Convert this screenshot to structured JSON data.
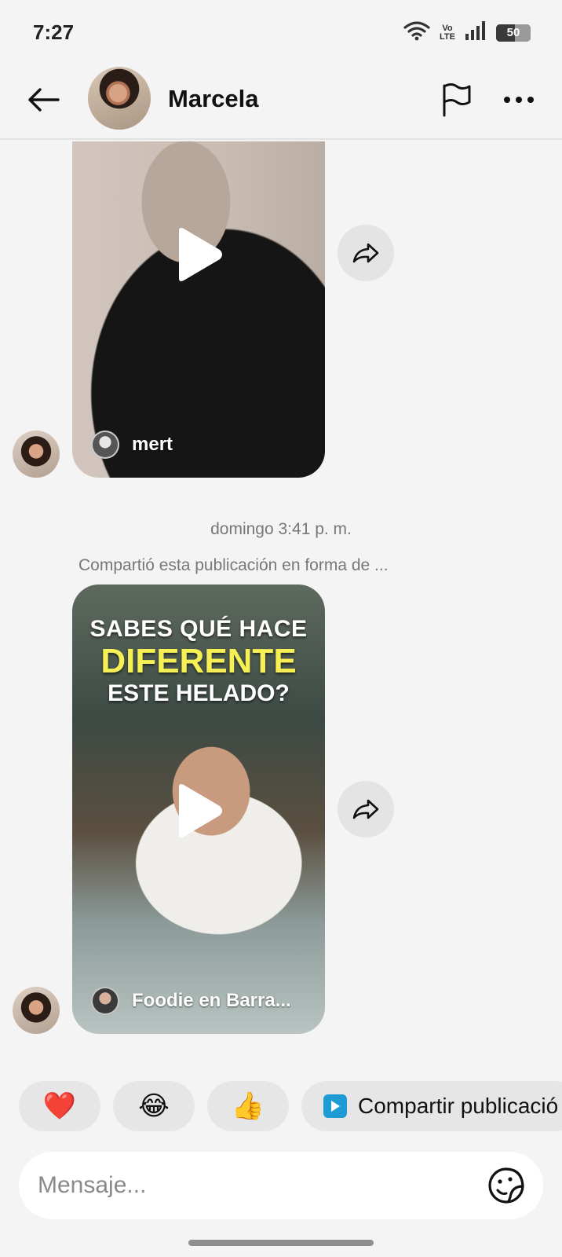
{
  "status_bar": {
    "time": "7:27",
    "volte_top": "Vo",
    "volte_bottom": "LTE",
    "battery": "50",
    "icons": [
      "wifi-icon",
      "volte-icon",
      "signal-icon",
      "battery-icon"
    ]
  },
  "header": {
    "contact_name": "Marcela",
    "icons": [
      "back-arrow-icon",
      "flag-icon",
      "more-dots-icon"
    ]
  },
  "messages": [
    {
      "type": "reel",
      "author": "mert",
      "icons": [
        "play-icon",
        "share-icon"
      ]
    },
    {
      "type": "reel",
      "timestamp": "domingo 3:41 p. m.",
      "shared_caption": "Compartió esta publicación en forma de ...",
      "title_line_1": "SABES QUÉ HACE",
      "title_line_2": "DIFERENTE",
      "title_line_3": "ESTE HELADO?",
      "author": "Foodie en Barra...",
      "icons": [
        "play-icon",
        "share-icon"
      ]
    }
  ],
  "quick_replies": {
    "heart": "❤️",
    "laugh": "😂",
    "thumbs_up": "👍",
    "share_post_label": "Compartir publicació"
  },
  "composer": {
    "placeholder": "Mensaje...",
    "icons": [
      "sticker-icon"
    ]
  },
  "colors": {
    "background": "#f4f4f4",
    "chip_background": "#e6e6e6",
    "reel_badge": "#1e9bd4",
    "highlight_title": "#f6f055"
  }
}
